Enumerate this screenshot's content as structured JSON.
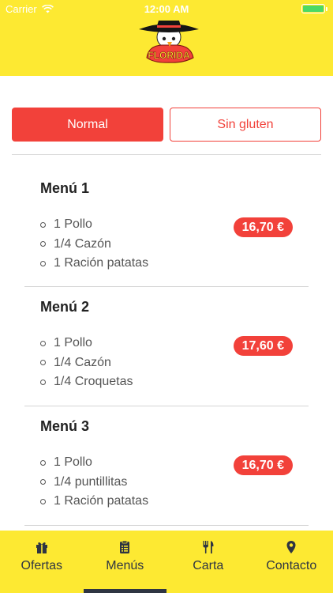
{
  "status_bar": {
    "carrier": "Carrier",
    "time": "12:00 AM"
  },
  "brand": {
    "logo_text": "FLORIDA"
  },
  "segments": {
    "normal": "Normal",
    "gluten_free": "Sin gluten",
    "active": "Normal"
  },
  "menus": [
    {
      "title": "Menú 1",
      "items": [
        "1 Pollo",
        "1/4 Cazón",
        "1 Ración patatas"
      ],
      "price": "16,70 €"
    },
    {
      "title": "Menú 2",
      "items": [
        "1 Pollo",
        "1/4 Cazón",
        "1/4 Croquetas"
      ],
      "price": "17,60 €"
    },
    {
      "title": "Menú 3",
      "items": [
        "1 Pollo",
        "1/4 puntillitas",
        "1 Ración patatas"
      ],
      "price": "16,70 €"
    }
  ],
  "tabs": [
    {
      "label": "Ofertas",
      "icon": "gift-icon"
    },
    {
      "label": "Menús",
      "icon": "clipboard-icon",
      "active": true
    },
    {
      "label": "Carta",
      "icon": "fork-knife-icon"
    },
    {
      "label": "Contacto",
      "icon": "location-pin-icon"
    }
  ],
  "colors": {
    "brand_yellow": "#fde932",
    "accent_red": "#f2413a",
    "dark": "#2f3542"
  }
}
